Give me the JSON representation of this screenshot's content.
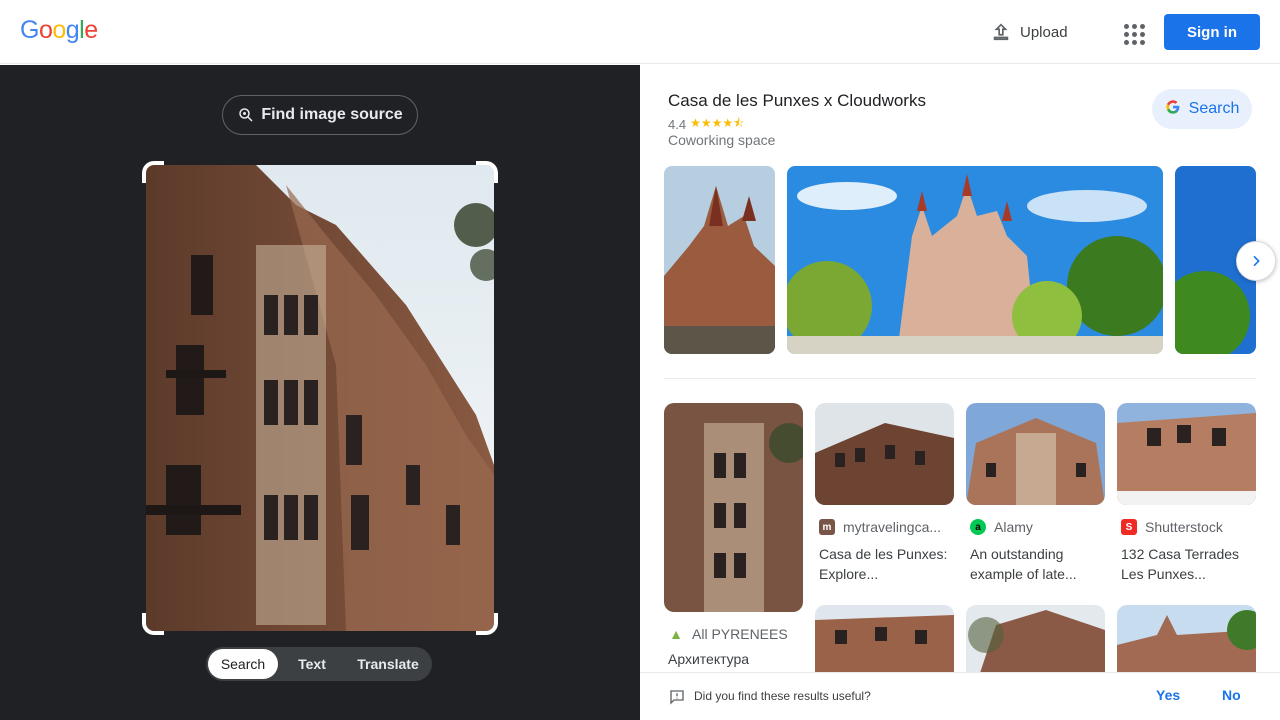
{
  "header": {
    "logo_letters": [
      {
        "ch": "G",
        "color": "#4285F4"
      },
      {
        "ch": "o",
        "color": "#EA4335"
      },
      {
        "ch": "o",
        "color": "#FBBC05"
      },
      {
        "ch": "g",
        "color": "#4285F4"
      },
      {
        "ch": "l",
        "color": "#34A853"
      },
      {
        "ch": "e",
        "color": "#EA4335"
      }
    ],
    "upload_label": "Upload",
    "upload_icon": "upload-icon",
    "apps_icon": "apps-grid-icon",
    "signin_label": "Sign in"
  },
  "lens": {
    "find_source_label": "Find image source",
    "find_source_icon": "lens-search-icon",
    "modes": [
      {
        "label": "Search",
        "active": true
      },
      {
        "label": "Text",
        "active": false
      },
      {
        "label": "Translate",
        "active": false
      }
    ]
  },
  "knowledge_panel": {
    "title": "Casa de les Punxes x Cloudworks",
    "rating": "4.4",
    "stars": "★★★★⯪",
    "category": "Coworking space",
    "search_label": "Search",
    "search_icon": "google-g-icon"
  },
  "results": [
    {
      "source": "All PYRENEES",
      "title": "Архитектура",
      "favicon_color": "#7cb342",
      "favicon_text": "▲"
    },
    {
      "source": "mytravelingca...",
      "title": "Casa de les Punxes: Explore...",
      "favicon_color": "#795548",
      "favicon_text": "m"
    },
    {
      "source": "Alamy",
      "title": "An outstanding example of late...",
      "favicon_color": "#00c853",
      "favicon_text": "a"
    },
    {
      "source": "Shutterstock",
      "title": "132 Casa Terrades Les Punxes...",
      "favicon_color": "#ee2b24",
      "favicon_text": "S"
    }
  ],
  "feedback": {
    "question": "Did you find these results useful?",
    "yes": "Yes",
    "no": "No"
  },
  "colors": {
    "primary": "#1a73e8",
    "dark_panel": "#202124",
    "star": "#fbbc04"
  }
}
